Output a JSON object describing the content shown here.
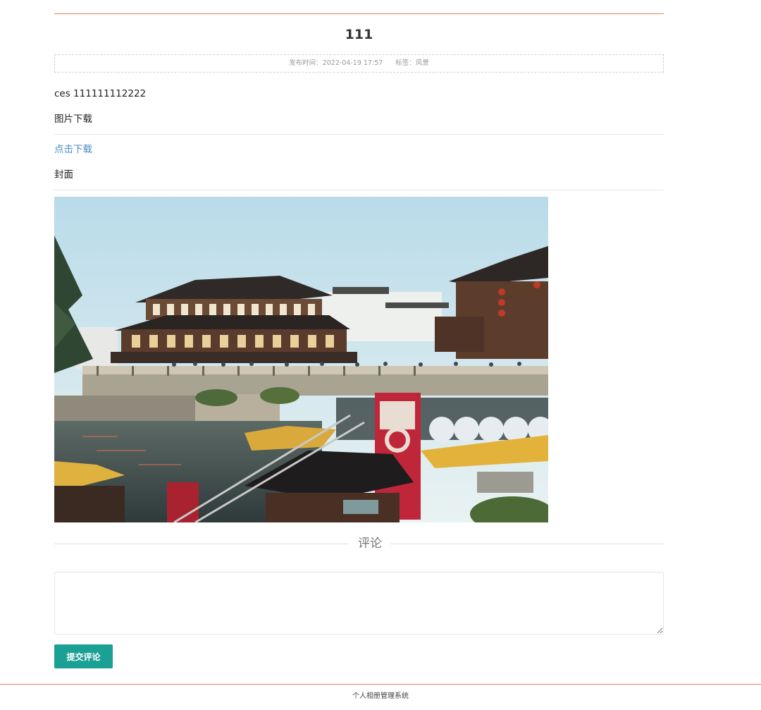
{
  "article": {
    "title": "111",
    "meta": {
      "publish_label": "发布时间：",
      "publish_time": "2022-04-19 17:57",
      "tag_label": "标签：",
      "tag": "风景"
    },
    "body_text": "ces 111111112222",
    "download_heading": "图片下载",
    "download_link": "点击下载",
    "cover_heading": "封面",
    "cover_image_icon": "photo-icon"
  },
  "comments": {
    "heading": "评论",
    "textarea_value": "",
    "submit_label": "提交评论",
    "submit_color": "#1aa094"
  },
  "footer": {
    "text": "个人相册管理系统"
  },
  "colors": {
    "accent_rule": "#e8804f",
    "link": "#4a8cc8"
  }
}
